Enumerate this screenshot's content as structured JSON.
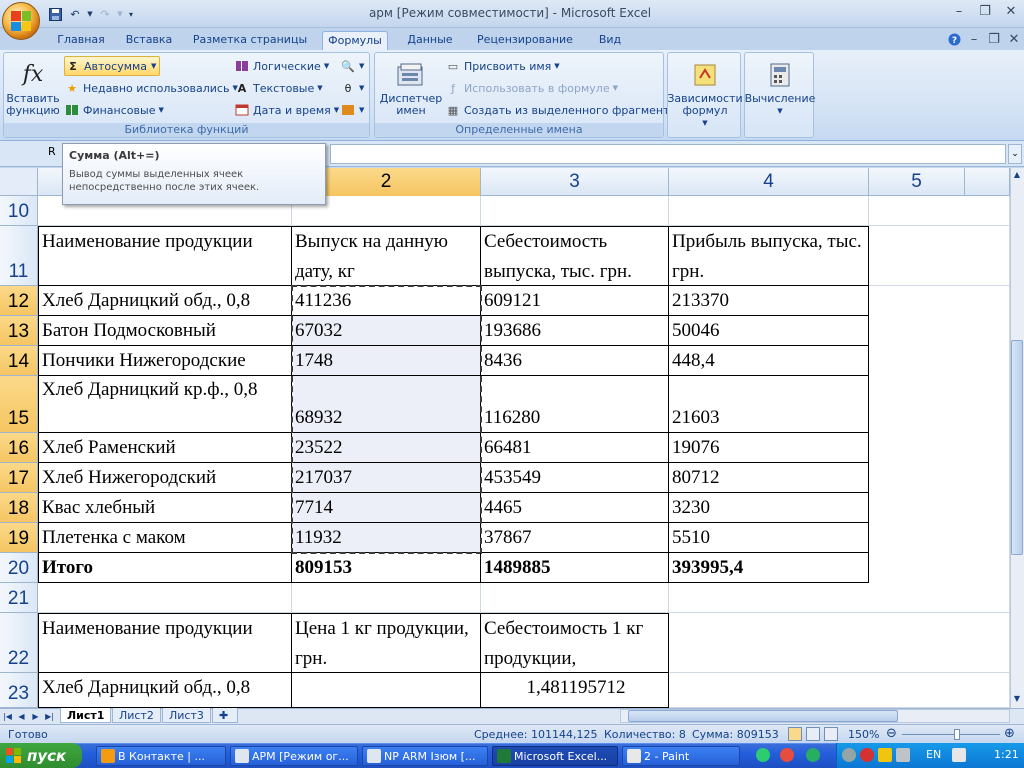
{
  "window": {
    "title": "арм  [Режим совместимости] - Microsoft Excel"
  },
  "ribbon_tabs": [
    "Главная",
    "Вставка",
    "Разметка страницы",
    "Формулы",
    "Данные",
    "Рецензирование",
    "Вид"
  ],
  "active_tab": "Формулы",
  "ribbon": {
    "insert_function": "Вставить функцию",
    "fx_glyph": "fx",
    "autosum": "Автосумма",
    "recent": "Недавно использовались",
    "financial": "Финансовые",
    "logical": "Логические",
    "text": "Текстовые",
    "datetime": "Дата и время",
    "group_library": "Библиотека функций",
    "name_manager": "Диспетчер имен",
    "assign_name": "Присвоить имя",
    "use_in_formula": "Использовать в формуле",
    "create_from_selection": "Создать из выделенного фрагмента",
    "group_names": "Определенные имена",
    "dependencies": "Зависимости формул",
    "calculation": "Вычисление"
  },
  "namebox": {
    "value": "R"
  },
  "tooltip": {
    "title": "Сумма (Alt+=)",
    "body": "Вывод суммы выделенных ячеек непосредственно после этих ячеек."
  },
  "columns": [
    "2",
    "3",
    "4",
    "5"
  ],
  "rows": [
    "10",
    "11",
    "12",
    "13",
    "14",
    "15",
    "16",
    "17",
    "18",
    "19",
    "20",
    "21",
    "22",
    "23"
  ],
  "table1": {
    "headers": [
      "Наименование продукции",
      "Выпуск на данную дату, кг",
      "Себестоимость выпуска, тыс. грн.",
      "Прибыль выпуска, тыс. грн."
    ],
    "rows": [
      [
        "Хлеб Дарницкий обд., 0,8",
        "411236",
        "609121",
        "213370"
      ],
      [
        "Батон Подмосковный",
        "67032",
        "193686",
        "50046"
      ],
      [
        "Пончики Нижегородские",
        "1748",
        "8436",
        "448,4"
      ],
      [
        "Хлеб Дарницкий кр.ф., 0,8",
        "68932",
        "116280",
        "21603"
      ],
      [
        "Хлеб Раменский",
        "23522",
        "66481",
        "19076"
      ],
      [
        "Хлеб Нижегородский",
        "217037",
        "453549",
        "80712"
      ],
      [
        "Квас хлебный",
        "7714",
        "4465",
        "3230"
      ],
      [
        "Плетенка с маком",
        "11932",
        "37867",
        "5510"
      ]
    ],
    "total": [
      "Итого",
      "809153",
      "1489885",
      "393995,4"
    ]
  },
  "table2": {
    "headers": [
      "Наименование продукции",
      "Цена 1 кг продукции, грн.",
      "Себестоимость 1 кг продукции,"
    ],
    "rows": [
      [
        "Хлеб Дарницкий обд., 0,8",
        "",
        "1,481195712"
      ]
    ]
  },
  "sheets": [
    "Лист1",
    "Лист2",
    "Лист3"
  ],
  "status": {
    "ready": "Готово",
    "average": "Среднее: 101144,125",
    "count": "Количество: 8",
    "sum": "Сумма: 809153",
    "zoom": "150%"
  },
  "taskbar": {
    "start": "пуск",
    "tasks": [
      "В Контакте | ...",
      "АРМ [Режим ог...",
      "NP ARM Ізюм [...",
      "Microsoft Excel...",
      "2 - Paint"
    ],
    "lang": "EN",
    "time": "1:21"
  }
}
